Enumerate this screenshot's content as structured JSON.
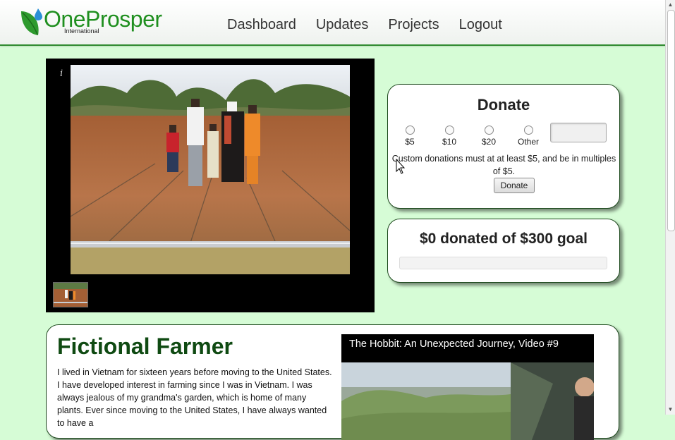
{
  "brand": {
    "name": "OneProsper",
    "sub": "International"
  },
  "nav": {
    "items": [
      {
        "label": "Dashboard"
      },
      {
        "label": "Updates"
      },
      {
        "label": "Projects"
      },
      {
        "label": "Logout"
      }
    ]
  },
  "gallery": {
    "info_glyph": "i"
  },
  "donate": {
    "title": "Donate",
    "options": [
      {
        "label": "$5"
      },
      {
        "label": "$10"
      },
      {
        "label": "$20"
      },
      {
        "label": "Other"
      }
    ],
    "custom_amount_value": "",
    "note": "Custom donations must at at least $5, and be in multiples of $5.",
    "button_label": "Donate"
  },
  "goal": {
    "text": "$0 donated of $300 goal",
    "donated": 0,
    "target": 300
  },
  "story": {
    "name": "Fictional Farmer",
    "bio": "I lived in Vietnam for sixteen years before moving to the United States. I have developed interest in farming since I was in Vietnam. I was always jealous of my grandma's garden, which is home of many plants. Ever since moving to the United States, I have always wanted to have a"
  },
  "video": {
    "title": "The Hobbit: An Unexpected Journey, Video #9"
  },
  "colors": {
    "background": "#d6fcd6",
    "brand_green": "#1f8f1f",
    "heading_green": "#0f4a12"
  }
}
